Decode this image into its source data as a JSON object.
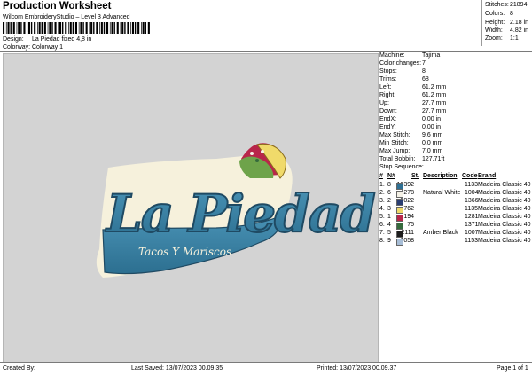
{
  "header": {
    "title": "Production Worksheet",
    "subtitle": "Wilcom EmbroideryStudio – Level 3 Advanced",
    "design_label": "Design:",
    "design_value": "La Piedad fixed 4,8 in",
    "colorway_label": "Colorway:",
    "colorway_value": "Colorway 1"
  },
  "stats": [
    {
      "label": "Stitches:",
      "value": "21894"
    },
    {
      "label": "Colors:",
      "value": "8"
    },
    {
      "label": "Height:",
      "value": "2.18 in"
    },
    {
      "label": "Width:",
      "value": "4.82 in"
    },
    {
      "label": "Zoom:",
      "value": "1:1"
    }
  ],
  "design": {
    "main_text": "La Piedad",
    "tagline": "Tacos Y Mariscos"
  },
  "machine_info": [
    {
      "label": "Machine:",
      "value": "Tajima"
    },
    {
      "label": "Color changes:",
      "value": "7"
    },
    {
      "label": "Stops:",
      "value": "8"
    },
    {
      "label": "Trims:",
      "value": "68"
    },
    {
      "label": "Left:",
      "value": "61.2 mm"
    },
    {
      "label": "Right:",
      "value": "61.2 mm"
    },
    {
      "label": "Up:",
      "value": "27.7 mm"
    },
    {
      "label": "Down:",
      "value": "27.7 mm"
    },
    {
      "label": "EndX:",
      "value": "0.00 in"
    },
    {
      "label": "EndY:",
      "value": "0.00 in"
    },
    {
      "label": "Max Stitch:",
      "value": "9.6 mm"
    },
    {
      "label": "Min Stitch:",
      "value": "0.0 mm"
    },
    {
      "label": "Max Jump:",
      "value": "7.0 mm"
    },
    {
      "label": "Total Bobbin:",
      "value": "127.71ft"
    }
  ],
  "stop_sequence": {
    "title": "Stop Sequence:",
    "headers": {
      "num": "#",
      "n": "N#",
      "st": "St.",
      "desc": "Description",
      "code": "Code",
      "brand": "Brand"
    },
    "rows": [
      {
        "num": "1.",
        "n": "8",
        "color": "#2e6f93",
        "st": "10392",
        "desc": "",
        "code": "1133",
        "brand": "Madeira Classic 40"
      },
      {
        "num": "2.",
        "n": "6",
        "color": "#f4f1e6",
        "st": "4278",
        "desc": "Natural White",
        "code": "1004",
        "brand": "Madeira Classic 40"
      },
      {
        "num": "3.",
        "n": "2",
        "color": "#2b3f73",
        "st": "3022",
        "desc": "",
        "code": "1366",
        "brand": "Madeira Classic 40"
      },
      {
        "num": "4.",
        "n": "3",
        "color": "#f0da6a",
        "st": "762",
        "desc": "",
        "code": "1135",
        "brand": "Madeira Classic 40"
      },
      {
        "num": "5.",
        "n": "1",
        "color": "#b8264a",
        "st": "194",
        "desc": "",
        "code": "1281",
        "brand": "Madeira Classic 40"
      },
      {
        "num": "6.",
        "n": "4",
        "color": "#356a3c",
        "st": "75",
        "desc": "",
        "code": "1371",
        "brand": "Madeira Classic 40"
      },
      {
        "num": "7.",
        "n": "5",
        "color": "#1d1d1d",
        "st": "2111",
        "desc": "Amber Black",
        "code": "1007",
        "brand": "Madeira Classic 40"
      },
      {
        "num": "8.",
        "n": "9",
        "color": "#a7bdd6",
        "st": "1058",
        "desc": "",
        "code": "1153",
        "brand": "Madeira Classic 40"
      }
    ]
  },
  "footer": {
    "created_by": "Created By:",
    "last_saved": "Last Saved: 13/07/2023 00.09.35",
    "printed": "Printed: 13/07/2023 00.09.37",
    "page": "Page 1 of 1"
  }
}
